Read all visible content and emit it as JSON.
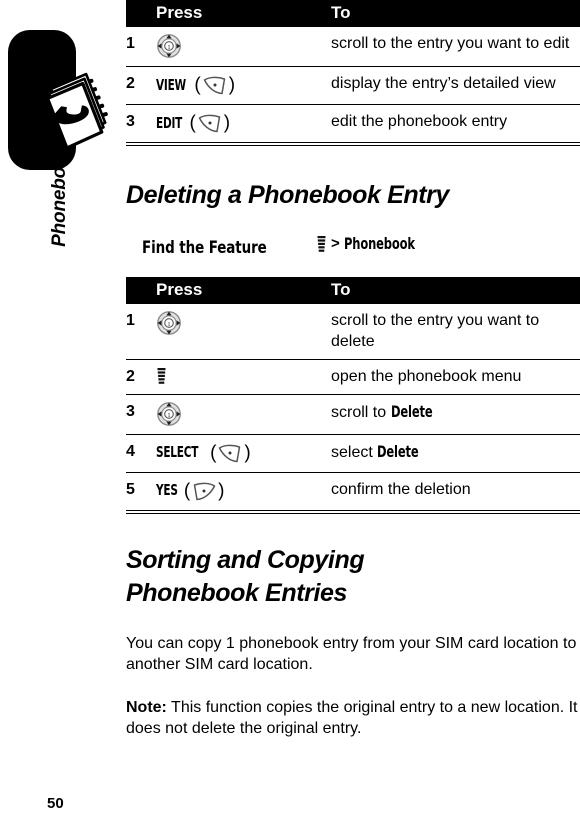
{
  "chapter": {
    "label": "Phonebook",
    "icon": "phonebook-icon"
  },
  "page": {
    "number": "50"
  },
  "table_columns": {
    "num": "",
    "press": "Press",
    "to": "To"
  },
  "table_one": {
    "rows": [
      {
        "num": "1",
        "press_icon": "navigation-key-icon",
        "press_label": "",
        "to": "scroll to the entry you want to edit"
      },
      {
        "num": "2",
        "press_icon": "right-soft-key-icon",
        "press_label": "VIEW",
        "to": "display the entry’s detailed view"
      },
      {
        "num": "3",
        "press_icon": "right-soft-key-icon",
        "press_label": "EDIT",
        "to": "edit the phonebook entry"
      }
    ]
  },
  "section_delete": {
    "heading": "Deleting a Phonebook Entry",
    "find_the_feature": {
      "label": "Find the Feature",
      "menu_icon": "menu-key-icon",
      "separator": ">",
      "target": "Phonebook"
    }
  },
  "table_two": {
    "rows": [
      {
        "num": "1",
        "press_icon": "navigation-key-icon",
        "press_label": "",
        "to": "scroll to the entry you want to delete",
        "to_bold": ""
      },
      {
        "num": "2",
        "press_icon": "menu-key-icon",
        "press_label": "",
        "to": "open the phonebook menu",
        "to_bold": ""
      },
      {
        "num": "3",
        "press_icon": "navigation-key-icon",
        "press_label": "",
        "to": "scroll to ",
        "to_bold": "Delete"
      },
      {
        "num": "4",
        "press_icon": "right-soft-key-icon",
        "press_label": "SELECT",
        "to": "select ",
        "to_bold": "Delete"
      },
      {
        "num": "5",
        "press_icon": "left-soft-key-icon",
        "press_label": "YES",
        "to": "confirm the deletion",
        "to_bold": ""
      }
    ]
  },
  "section_sorting": {
    "heading_line1": "Sorting and Copying",
    "heading_line2": "Phonebook Entries",
    "paragraph": "You can copy 1 phonebook entry from your SIM card location to another SIM card location.",
    "note_label": "Note:",
    "note_text": " This function copies the original entry to a new location. It does not delete the original entry."
  },
  "colors": {
    "ink": "#000000",
    "paper": "#ffffff",
    "key_gray": "#9a9a9a"
  }
}
